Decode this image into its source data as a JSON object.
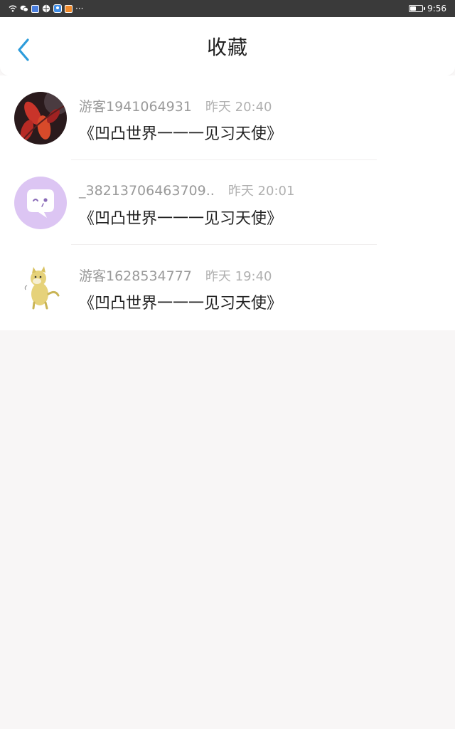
{
  "status_bar": {
    "overflow_dots": "···",
    "time": "9:56",
    "battery_level": 0.45,
    "icons": [
      "wifi-icon",
      "wechat-icon",
      "app-blue-icon",
      "app-globe-icon",
      "app-location-icon",
      "app-orange-icon"
    ]
  },
  "header": {
    "title": "收藏",
    "back_icon": "chevron-left-icon",
    "accent": "#2d9cdb"
  },
  "list": {
    "items": [
      {
        "username": "游客1941064931",
        "time": "昨天 20:40",
        "title": "《凹凸世界一一一见习天使》",
        "avatar": "red-leaves-avatar"
      },
      {
        "username": "_38213706463709..",
        "time": "昨天 20:01",
        "title": "《凹凸世界一一一见习天使》",
        "avatar": "purple-chat-bubble-avatar"
      },
      {
        "username": "游客1628534777",
        "time": "昨天 19:40",
        "title": "《凹凸世界一一一见习天使》",
        "avatar": "shiba-dog-avatar"
      }
    ]
  },
  "colors": {
    "background": "#f8f6f6",
    "status_bar": "#3a3a3a",
    "avatar_purple": "#d9c2f2"
  }
}
